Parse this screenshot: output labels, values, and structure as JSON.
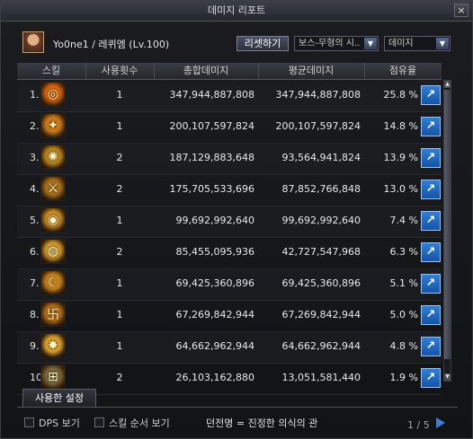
{
  "window": {
    "title": "데미지 리포트",
    "close_label": "×"
  },
  "character": {
    "name": "Yo0ne1 / 레퀴엠 (Lv.100)"
  },
  "toolbar": {
    "reset_label": "리셋하기",
    "boss_value": "보스-무형의 시..",
    "type_value": "데미지"
  },
  "columns": [
    "스킬",
    "사용횟수",
    "총합데미지",
    "평균데미지",
    "점유율"
  ],
  "rows": [
    {
      "num": "1.",
      "count": "1",
      "total": "347,944,887,808",
      "avg": "347,944,887,808",
      "pct": "25.8 %",
      "icon": "ring-sigil-icon",
      "color": "#d8620e"
    },
    {
      "num": "2.",
      "count": "1",
      "total": "200,107,597,824",
      "avg": "200,107,597,824",
      "pct": "14.8 %",
      "icon": "dancer-icon",
      "color": "#c8781a"
    },
    {
      "num": "3.",
      "count": "2",
      "total": "187,129,883,648",
      "avg": "93,564,941,824",
      "pct": "13.9 %",
      "icon": "star-burst-icon",
      "color": "#b9871e"
    },
    {
      "num": "4.",
      "count": "2",
      "total": "175,705,533,696",
      "avg": "87,852,766,848",
      "pct": "13.0 %",
      "icon": "blade-slash-icon",
      "color": "#a8701a"
    },
    {
      "num": "5.",
      "count": "1",
      "total": "99,692,992,640",
      "avg": "99,692,992,640",
      "pct": "7.4 %",
      "icon": "vortex-icon",
      "color": "#c88a22"
    },
    {
      "num": "6.",
      "count": "2",
      "total": "85,455,095,936",
      "avg": "42,727,547,968",
      "pct": "6.3 %",
      "icon": "target-orb-icon",
      "color": "#d29a2a"
    },
    {
      "num": "7.",
      "count": "1",
      "total": "69,425,360,896",
      "avg": "69,425,360,896",
      "pct": "5.1 %",
      "icon": "crescent-icon",
      "color": "#c2801c"
    },
    {
      "num": "8.",
      "count": "1",
      "total": "67,269,842,944",
      "avg": "67,269,842,944",
      "pct": "5.0 %",
      "icon": "rune-script-icon",
      "color": "#b8701a"
    },
    {
      "num": "9.",
      "count": "1",
      "total": "64,662,962,944",
      "avg": "64,662,962,944",
      "pct": "4.8 %",
      "icon": "light-beam-icon",
      "color": "#d8a030"
    },
    {
      "num": "10.",
      "count": "2",
      "total": "26,103,162,880",
      "avg": "13,051,581,440",
      "pct": "1.9 %",
      "icon": "cross-box-icon",
      "color": "#7a6a40"
    }
  ],
  "tab": {
    "label": "사용한 설정"
  },
  "footer": {
    "dps_label": "DPS 보기",
    "order_label": "스킬 순서 보기",
    "dungeon": "던전명 = 진정한 의식의 관",
    "page": "1 / 5"
  }
}
